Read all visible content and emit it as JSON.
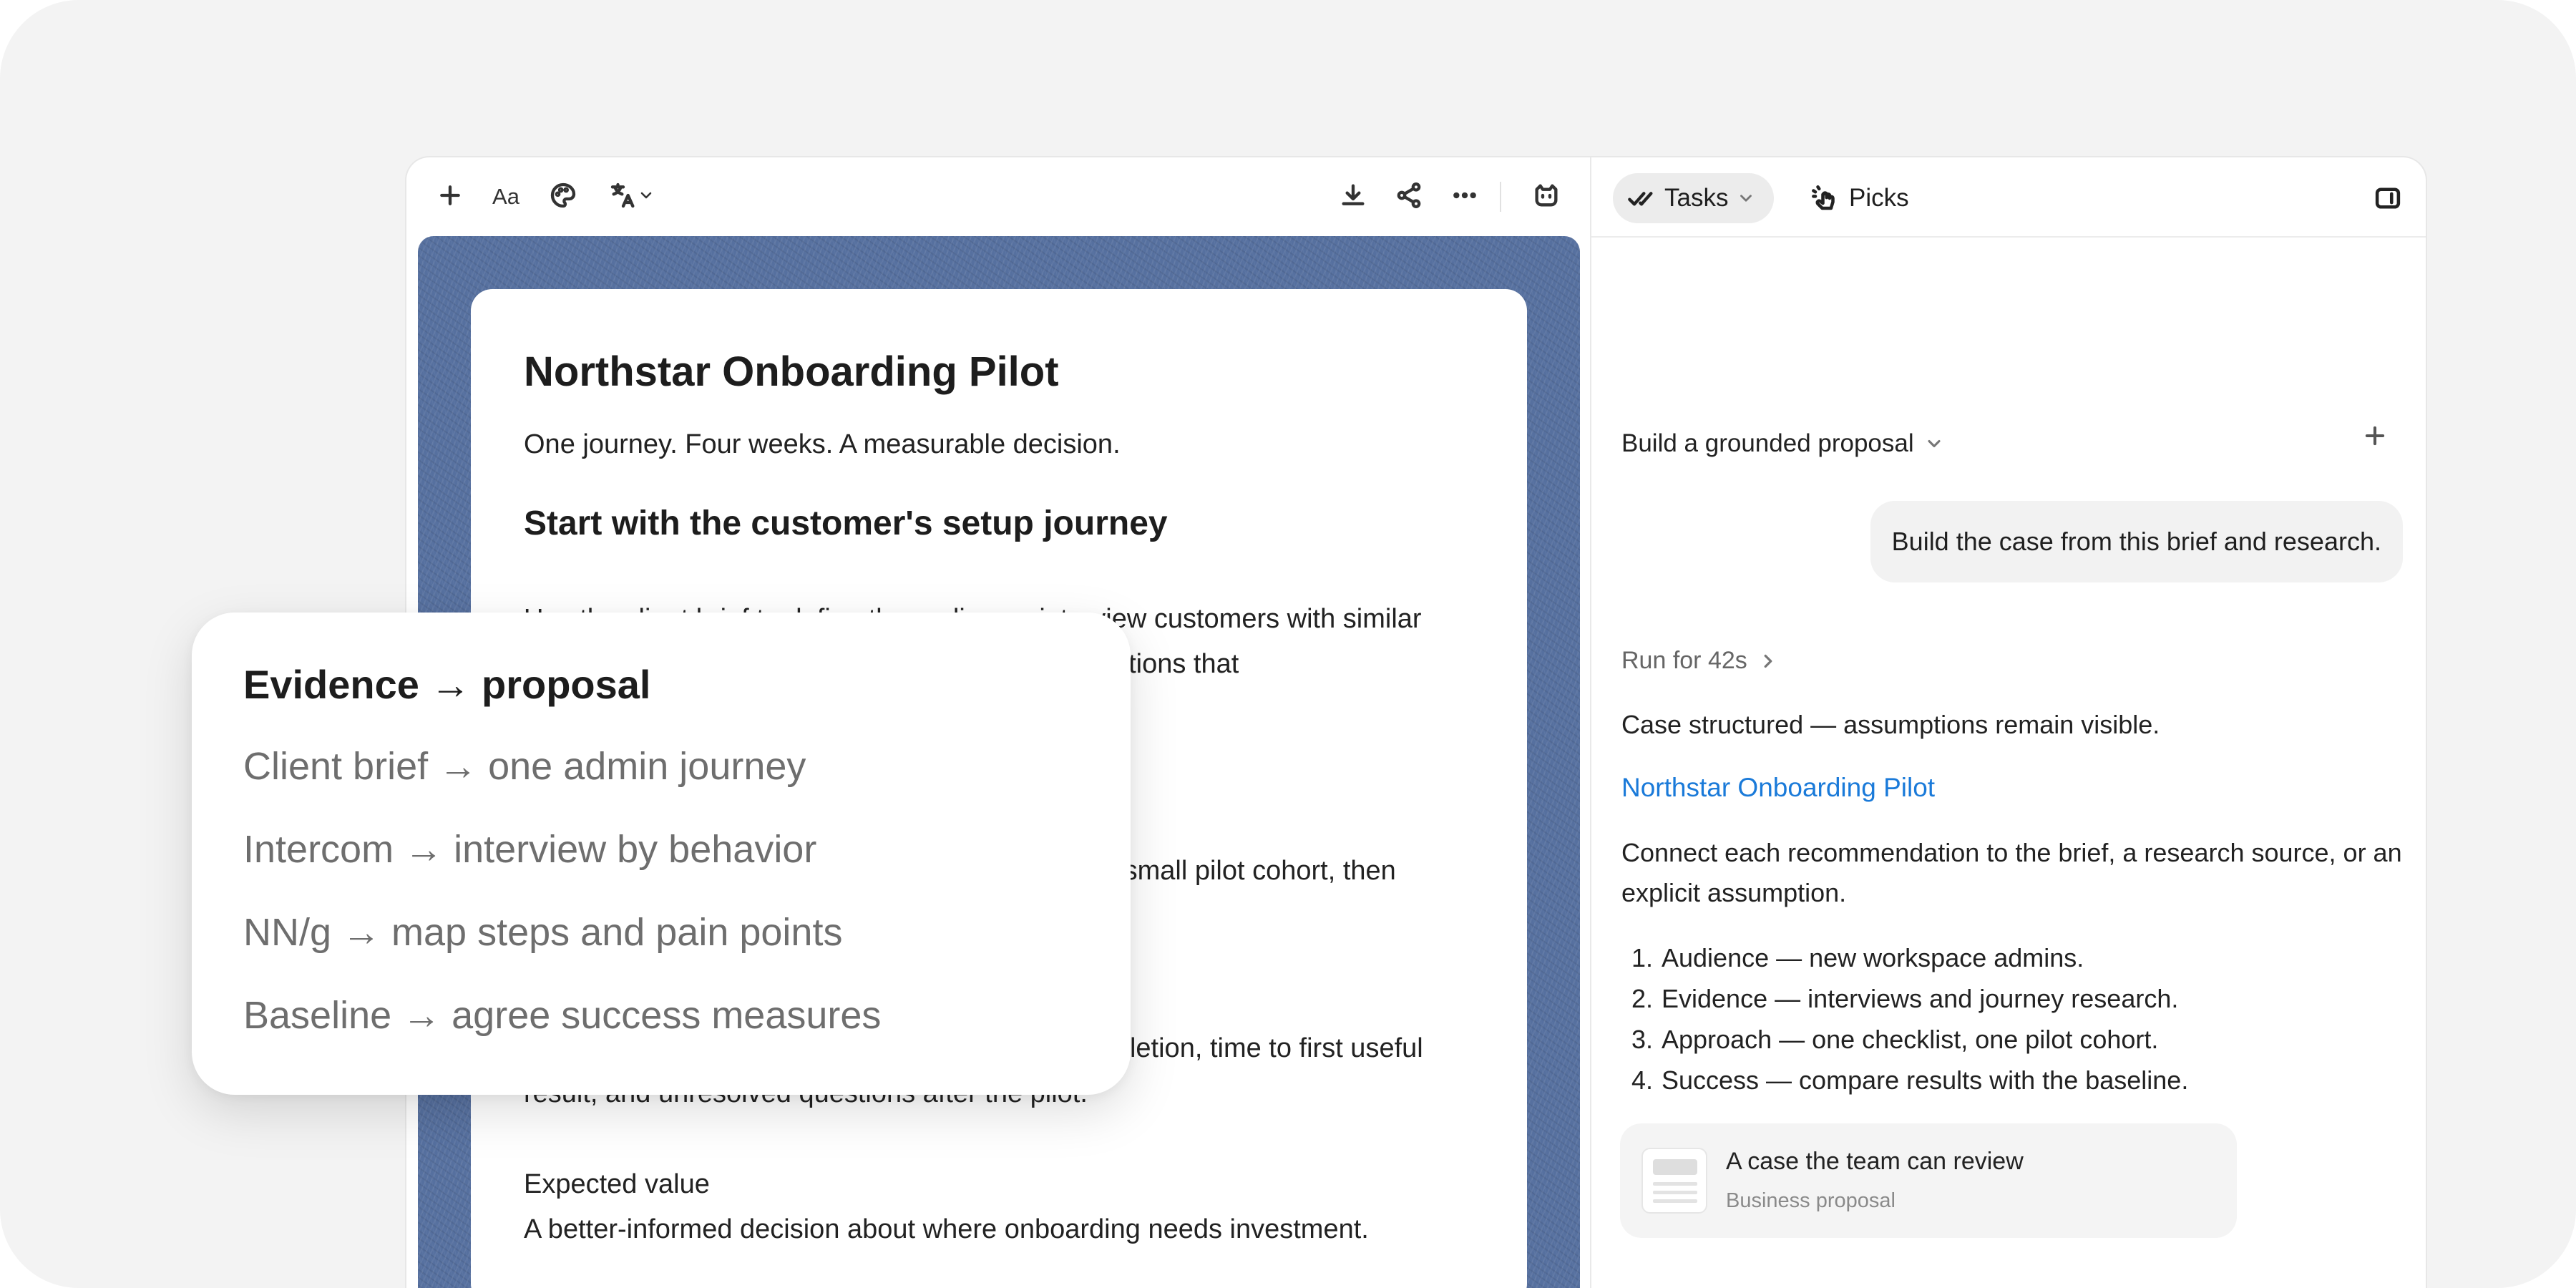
{
  "editor": {
    "toolbar": {
      "font_label": "Aa",
      "icons": [
        "plus-icon",
        "font-icon",
        "palette-icon",
        "translate-icon",
        "download-icon",
        "share-icon",
        "more-icon",
        "assistant-icon"
      ]
    },
    "doc": {
      "title": "Northstar Onboarding Pilot",
      "subtitle": "One journey. Four weeks. A measurable decision.",
      "heading": "Start with the customer's setup journey",
      "para1": "Use the client brief to define the audience, interview customers with similar onboarding behavior, and map the steps and questions that",
      "para2": "Test one focused onboarding improvement with a small pilot cohort, then compare it with the current setup journey.",
      "para3": "Agree the success measures up front: setup completion, time to first useful result, and unresolved questions after the pilot.",
      "expected_label": "Expected value",
      "expected_text": "A better-informed decision about where onboarding needs investment."
    }
  },
  "panel": {
    "tabs": [
      {
        "label": "Tasks",
        "icon": "double-check-icon",
        "active": true
      },
      {
        "label": "Picks",
        "icon": "pointer-click-icon",
        "active": false
      }
    ],
    "thread_title": "Build a grounded proposal",
    "user_message": "Build the case from this brief and research.",
    "run_label": "Run for 42s",
    "summary": "Case structured — assumptions remain visible.",
    "doc_link": "Northstar Onboarding Pilot",
    "instruction": "Connect each recommendation to the brief, a research source, or an explicit assumption.",
    "steps": [
      {
        "n": "1.",
        "text": "Audience — new workspace admins."
      },
      {
        "n": "2.",
        "text": "Evidence — interviews and journey research."
      },
      {
        "n": "3.",
        "text": "Approach — one checklist, one pilot cohort."
      },
      {
        "n": "4.",
        "text": "Success — compare results with the baseline."
      }
    ],
    "attachment": {
      "title": "A case the team can review",
      "subtitle": "Business proposal"
    }
  },
  "overlay": {
    "title": "Evidence → proposal",
    "items": [
      "Client brief → one admin journey",
      "Intercom → interview by behavior",
      "NN/g → map steps and pain points",
      "Baseline → agree success measures"
    ]
  },
  "colors": {
    "link": "#1a7ad9",
    "canvas": "#56709f",
    "backdrop": "#f3f3f3"
  }
}
